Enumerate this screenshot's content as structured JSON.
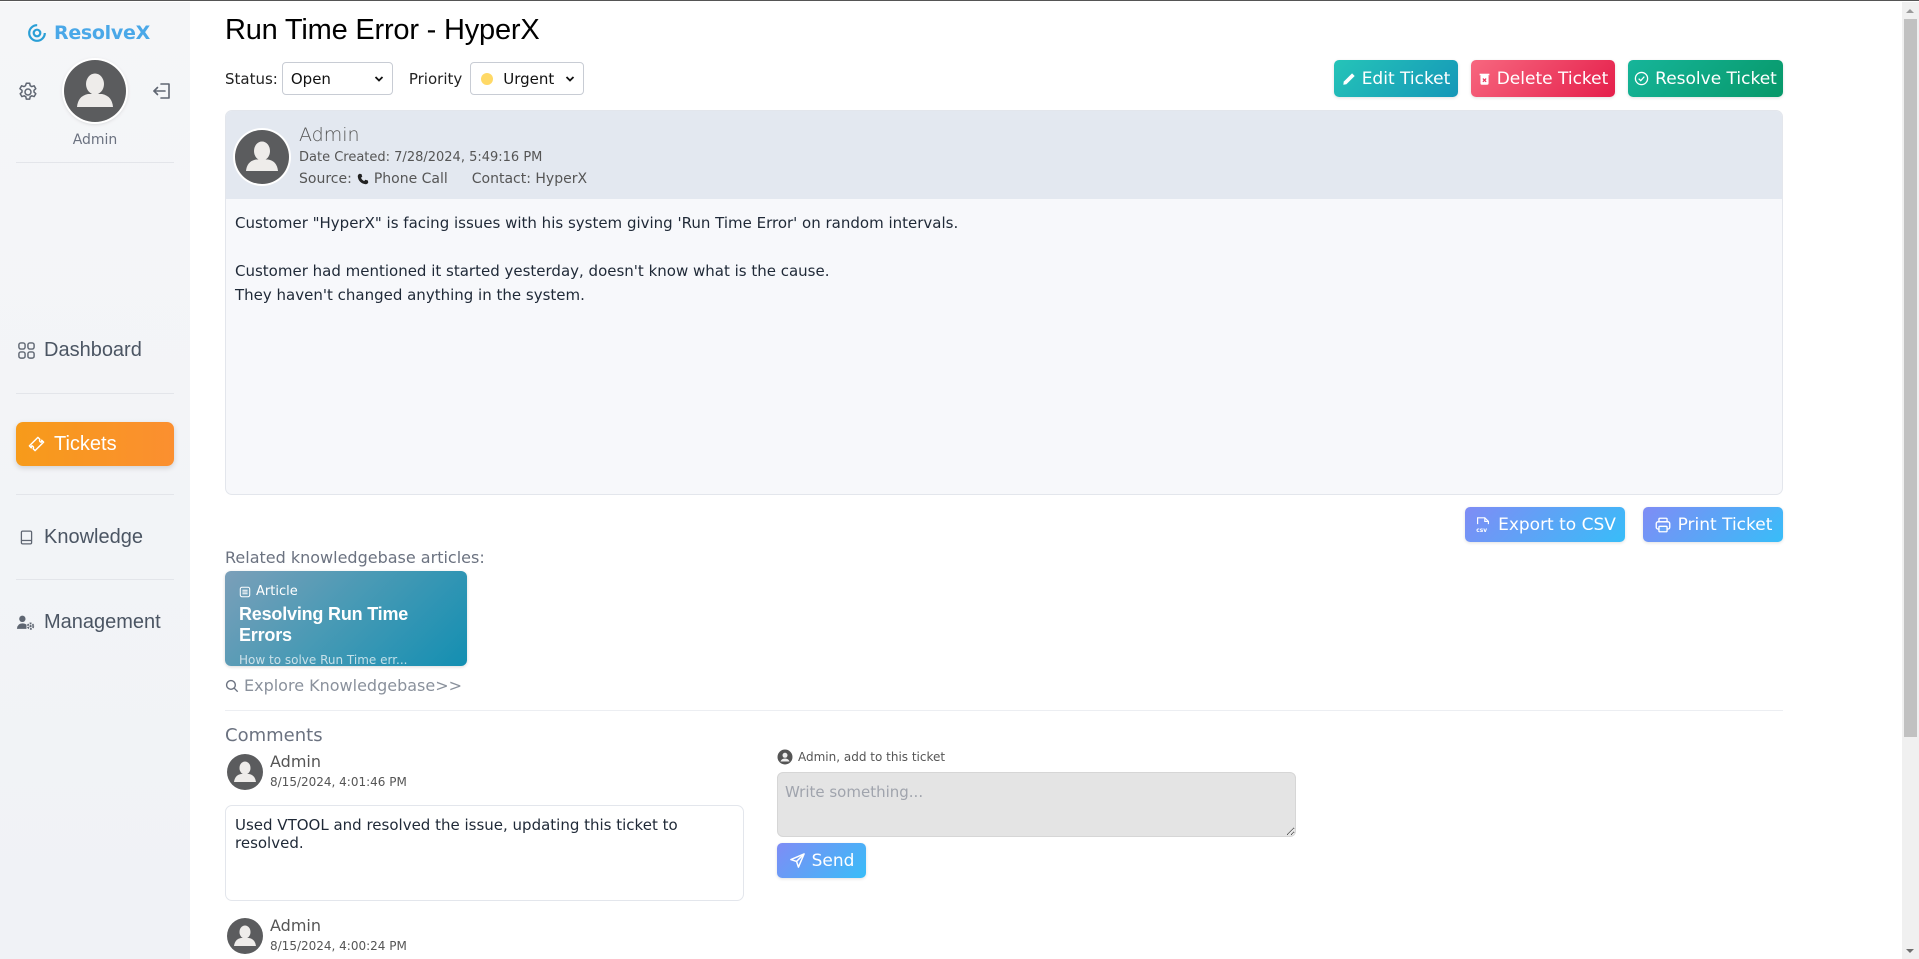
{
  "sidebar": {
    "brand": "ResolveX",
    "user_name": "Admin",
    "nav": [
      {
        "label": "Dashboard",
        "icon": "grid-icon",
        "active": false
      },
      {
        "label": "Tickets",
        "icon": "ticket-icon",
        "active": true
      },
      {
        "label": "Knowledge",
        "icon": "book-icon",
        "active": false
      },
      {
        "label": "Management",
        "icon": "user-gear-icon",
        "active": false
      }
    ]
  },
  "header": {
    "title": "Run Time Error - HyperX",
    "status_label": "Status:",
    "status_value": "Open",
    "priority_label": "Priority",
    "priority_value": "Urgent",
    "priority_color": "#ffd966"
  },
  "actions": {
    "edit": "Edit Ticket",
    "delete": "Delete Ticket",
    "resolve": "Resolve Ticket",
    "export": "Export to CSV",
    "print": "Print Ticket"
  },
  "ticket": {
    "author": "Admin",
    "date_created": "Date Created: 7/28/2024, 5:49:16 PM",
    "source_label": "Source:",
    "source_value": "Phone Call",
    "contact": "Contact: HyperX",
    "body": [
      "Customer \"HyperX\" is facing issues with his system giving 'Run Time Error' on random intervals.",
      "",
      "Customer had mentioned it started yesterday, doesn't know what is the cause.",
      "They haven't changed anything in the system."
    ]
  },
  "knowledge": {
    "related_label": "Related knowledgebase articles:",
    "articles": [
      {
        "tag": "Article",
        "title": "Resolving Run Time Errors",
        "summary": "How to solve Run Time err..."
      }
    ],
    "explore_label": "Explore Knowledgebase>>"
  },
  "comments": {
    "title": "Comments",
    "items": [
      {
        "author": "Admin",
        "date": "8/15/2024, 4:01:46 PM",
        "text": "Used VTOOL and resolved the issue, updating this ticket to resolved."
      },
      {
        "author": "Admin",
        "date": "8/15/2024, 4:00:24 PM",
        "text": ""
      }
    ],
    "add_label": "Admin, add to this ticket",
    "input_placeholder": "Write something...",
    "input_value": "",
    "send_label": "Send"
  },
  "colors": {
    "brand": "#4aa8e8",
    "active_nav": "#f79b1a",
    "edit": "#1aaeb8",
    "delete": "#ee3a5e",
    "resolve": "#0fa77f",
    "secondary": "#5fa8f6"
  }
}
